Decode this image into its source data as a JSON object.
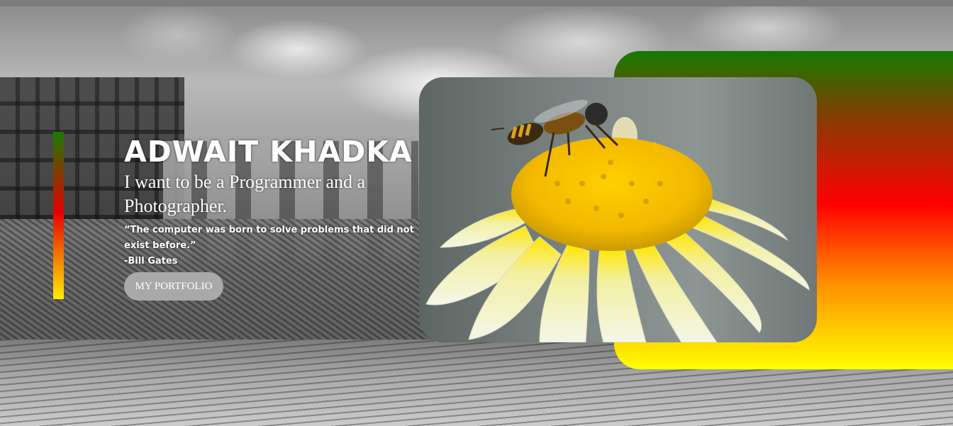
{
  "hero": {
    "name": "ADWAIT KHADKA",
    "tagline": "I want to be a Programmer and a Photographer.",
    "quote": "“The computer was born to solve problems that did not exist before.”",
    "author": "-Bill Gates",
    "button_label": "MY PORTFOLIO"
  },
  "colors": {
    "accent_green": "#1a7a00",
    "accent_red": "#e60000",
    "accent_yellow": "#ffee00",
    "button_bg": "#a9a9a9"
  },
  "images": {
    "background": "grayscale-construction-site-photo",
    "featured": "bee-on-daisy-photo"
  }
}
